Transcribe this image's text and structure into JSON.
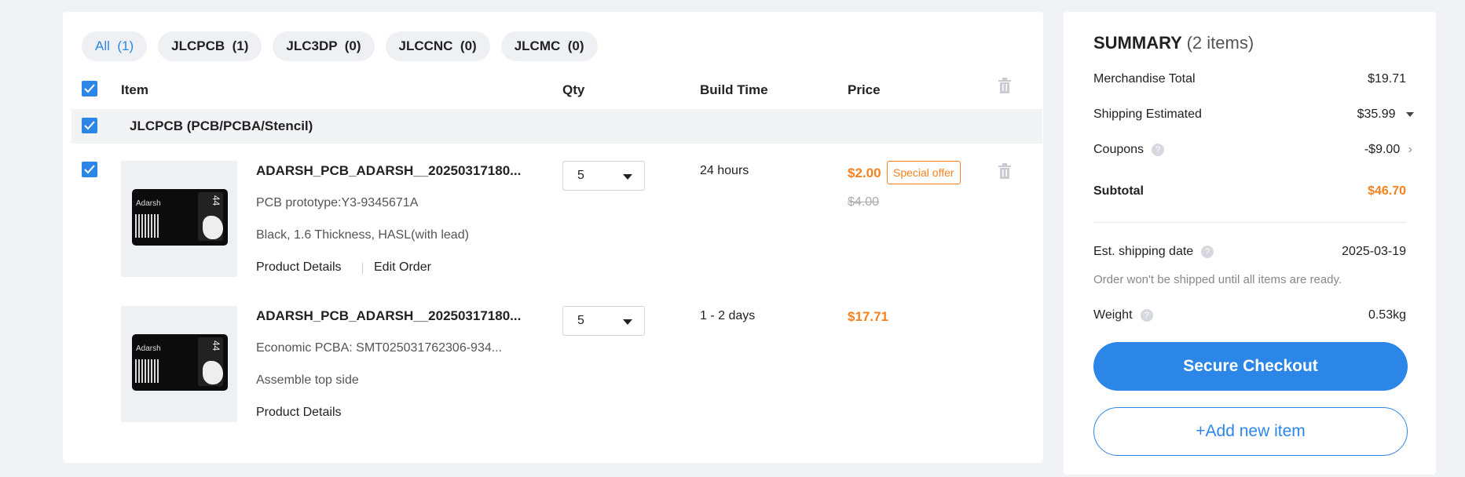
{
  "tabs": [
    {
      "label": "All",
      "count": "(1)"
    },
    {
      "label": "JLCPCB",
      "count": "(1)"
    },
    {
      "label": "JLC3DP",
      "count": "(0)"
    },
    {
      "label": "JLCCNC",
      "count": "(0)"
    },
    {
      "label": "JLCMC",
      "count": "(0)"
    }
  ],
  "columns": {
    "item": "Item",
    "qty": "Qty",
    "build_time": "Build Time",
    "price": "Price"
  },
  "group": {
    "title": "JLCPCB (PCB/PCBA/Stencil)"
  },
  "board": {
    "name": "Adarsh",
    "number": "44"
  },
  "items": [
    {
      "title": "ADARSH_PCB_ADARSH__20250317180...",
      "line1": "PCB prototype:Y3-9345671A",
      "line2": "Black, 1.6 Thickness, HASL(with lead)",
      "link1": "Product Details",
      "link2": "Edit Order",
      "qty": "5",
      "build_time": "24 hours",
      "price": "$2.00",
      "badge": "Special offer",
      "old_price": "$4.00"
    },
    {
      "title": "ADARSH_PCB_ADARSH__20250317180...",
      "line1": "Economic PCBA: SMT025031762306-934...",
      "line2": "Assemble top side",
      "link1": "Product Details",
      "qty": "5",
      "build_time": "1 - 2 days",
      "price": "$17.71"
    }
  ],
  "summary": {
    "title": "SUMMARY",
    "count": "(2 items)",
    "merch_label": "Merchandise Total",
    "merch_value": "$19.71",
    "shipping_label": "Shipping Estimated",
    "shipping_value": "$35.99",
    "coupons_label": "Coupons",
    "coupons_value": "-$9.00",
    "subtotal_label": "Subtotal",
    "subtotal_value": "$46.70",
    "ship_date_label": "Est. shipping date",
    "ship_date_value": "2025-03-19",
    "note": "Order won't be shipped until all items are ready.",
    "weight_label": "Weight",
    "weight_value": "0.53kg",
    "checkout_label": "Secure Checkout",
    "add_label": "+Add new item"
  },
  "colors": {
    "accent": "#2c86e8",
    "price": "#f5821f"
  }
}
